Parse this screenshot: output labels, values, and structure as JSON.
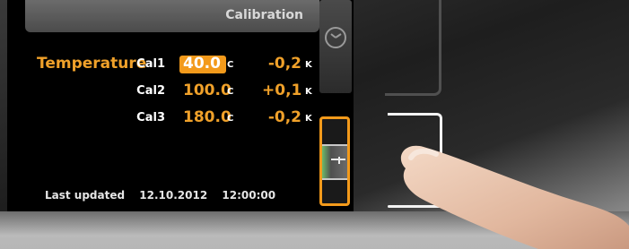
{
  "header": {
    "title": "Calibration"
  },
  "parameter": {
    "label": "Temperature"
  },
  "calibrations": [
    {
      "label": "Cal1",
      "value": "40.0",
      "unit": "C",
      "delta": "-0,2",
      "delta_unit": "K",
      "selected": true
    },
    {
      "label": "Cal2",
      "value": "100.0",
      "unit": "C",
      "delta": "+0,1",
      "delta_unit": "K",
      "selected": false
    },
    {
      "label": "Cal3",
      "value": "180.0",
      "unit": "C",
      "delta": "-0,2",
      "delta_unit": "K",
      "selected": false
    }
  ],
  "footer": {
    "label": "Last updated",
    "date": "12.10.2012",
    "time": "12:00:00"
  },
  "colors": {
    "accent": "#f39a1b",
    "text_orange": "#f0a12a",
    "screen_bg": "#000000"
  },
  "icons": {
    "clock": "clock-icon",
    "scroll": "scroll-bar"
  }
}
